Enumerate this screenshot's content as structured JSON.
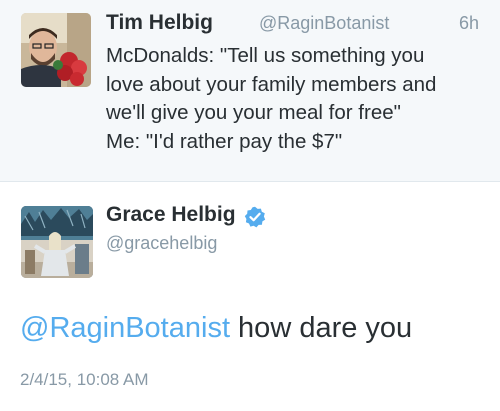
{
  "reply_tweet": {
    "author_name": "Tim Helbig",
    "author_handle": "@RaginBotanist",
    "time_ago": "6h",
    "lines": [
      "McDonalds: \"Tell us something you",
      "love about your family members and",
      "we'll give you your meal for free\"",
      "Me: \"I'd rather pay the $7\""
    ]
  },
  "main_tweet": {
    "author_name": "Grace Helbig",
    "author_handle": "@gracehelbig",
    "verified": true,
    "mention": "@RaginBotanist",
    "text": " how dare you",
    "timestamp": "2/4/15, 10:08 AM"
  },
  "colors": {
    "link": "#55acee",
    "verified_badge": "#55acee",
    "text": "#292f33",
    "muted": "#8899a6",
    "context_background": "#f5f8fa"
  },
  "icons": {
    "verified": "verified-badge-icon"
  }
}
